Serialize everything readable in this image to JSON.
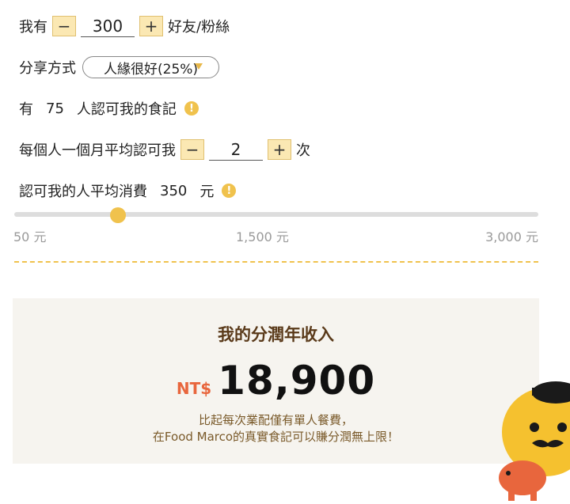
{
  "friends": {
    "prefix": "我有",
    "minus": "−",
    "value": "300",
    "plus": "+",
    "suffix": "好友/粉絲"
  },
  "share": {
    "label": "分享方式",
    "selected": "人緣很好(25%)"
  },
  "approvers": {
    "prefix": "有",
    "count": "75",
    "suffix": "人認可我的食記"
  },
  "monthly": {
    "label": "每個人一個月平均認可我",
    "minus": "−",
    "value": "2",
    "plus": "+",
    "suffix": "次"
  },
  "spend": {
    "label": "認可我的人平均消費",
    "value": "350",
    "unit": "元"
  },
  "slider": {
    "min_label": "50 元",
    "mid_label": "1,500 元",
    "max_label": "3,000 元",
    "min": 50,
    "max": 3000,
    "value": 350
  },
  "result": {
    "title": "我的分潤年收入",
    "currency": "NT$",
    "amount": "18,900",
    "note_line1": "比起每次業配僅有單人餐費，",
    "note_line2": "在Food Marco的真實食記可以賺分潤無上限！"
  },
  "colors": {
    "accent": "#f0c24d",
    "button_bg": "#fbe8b3",
    "currency": "#e8663d",
    "card_bg": "#f6f4ef",
    "title": "#5a3a1a"
  },
  "icons": {
    "info": "info-icon",
    "mascot": "mascot-illustration"
  }
}
